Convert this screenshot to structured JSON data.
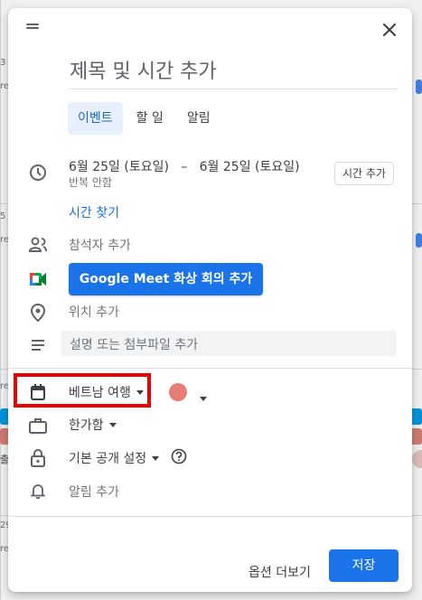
{
  "background": {
    "day_labels": [
      "3",
      "re",
      "5",
      "re",
      "re",
      "29",
      "re"
    ],
    "event_snippet": "출"
  },
  "dialog": {
    "close_icon": "close-icon",
    "title_placeholder": "제목 및 시간 추가",
    "tabs": [
      {
        "label": "이벤트",
        "active": true
      },
      {
        "label": "할 일",
        "active": false
      },
      {
        "label": "알림",
        "active": false
      }
    ],
    "date_range": "6월 25일 (토요일)   –   6월 25일 (토요일)",
    "repeat": "반복 안함",
    "add_time_label": "시간 추가",
    "find_time_label": "시간 찾기",
    "guests_label": "참석자 추가",
    "meet_button_label": "Google Meet 화상 회의 추가",
    "location_label": "위치 추가",
    "description_placeholder": "설명 또는 첨부파일 추가",
    "calendar_name": "베트남 여행",
    "calendar_color": "#e67c73",
    "busy_status": "한가함",
    "visibility": "기본 공개 설정",
    "notification_label": "알림 추가",
    "more_options_label": "옵션 더보기",
    "save_label": "저장",
    "highlight_color": "#ea0000",
    "accent_color": "#1a73e8"
  }
}
